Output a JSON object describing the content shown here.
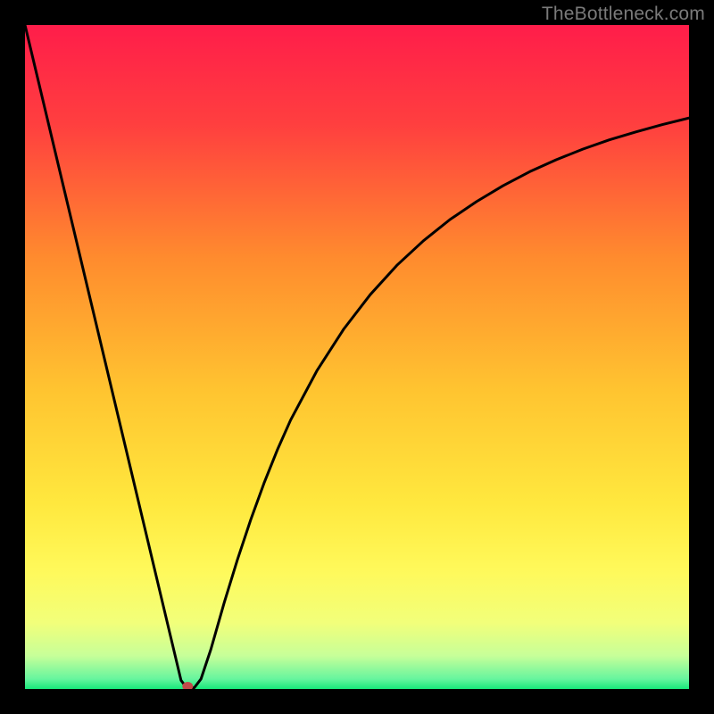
{
  "watermark": {
    "text": "TheBottleneck.com"
  },
  "chart_data": {
    "type": "line",
    "title": "",
    "xlabel": "",
    "ylabel": "",
    "xlim": [
      0,
      100
    ],
    "ylim": [
      0,
      100
    ],
    "grid": false,
    "legend": false,
    "background_gradient": {
      "stops": [
        {
          "offset": 0.0,
          "color": "#ff1d4a"
        },
        {
          "offset": 0.15,
          "color": "#ff3f3f"
        },
        {
          "offset": 0.35,
          "color": "#ff8b2e"
        },
        {
          "offset": 0.55,
          "color": "#ffc430"
        },
        {
          "offset": 0.72,
          "color": "#ffe83e"
        },
        {
          "offset": 0.82,
          "color": "#fff95a"
        },
        {
          "offset": 0.9,
          "color": "#f2ff7a"
        },
        {
          "offset": 0.95,
          "color": "#c7ff99"
        },
        {
          "offset": 0.985,
          "color": "#66f59e"
        },
        {
          "offset": 1.0,
          "color": "#17e87a"
        }
      ]
    },
    "series": [
      {
        "name": "bottleneck-curve",
        "x": [
          0,
          2,
          4,
          6,
          8,
          10,
          12,
          14,
          16,
          18,
          20,
          22,
          23.5,
          24.5,
          25.5,
          26.5,
          28,
          30,
          32,
          34,
          36,
          38,
          40,
          44,
          48,
          52,
          56,
          60,
          64,
          68,
          72,
          76,
          80,
          84,
          88,
          92,
          96,
          100
        ],
        "y": [
          100,
          91.6,
          83.2,
          74.8,
          66.4,
          58.0,
          49.6,
          41.2,
          32.8,
          24.4,
          16.0,
          7.6,
          1.3,
          0.0,
          0.2,
          1.5,
          6.0,
          13.0,
          19.5,
          25.5,
          31.0,
          36.0,
          40.5,
          48.0,
          54.2,
          59.4,
          63.8,
          67.5,
          70.7,
          73.4,
          75.8,
          77.9,
          79.7,
          81.3,
          82.7,
          83.9,
          85.0,
          86.0
        ]
      }
    ],
    "marker": {
      "x": 24.5,
      "y": 0,
      "color": "#c24a4a",
      "rx": 6,
      "ry": 5
    }
  }
}
